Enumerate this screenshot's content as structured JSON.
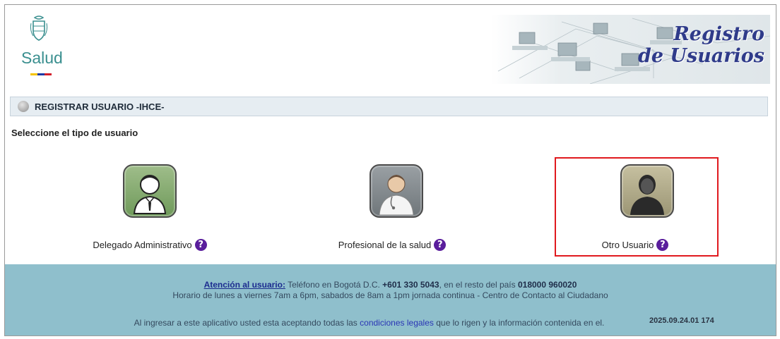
{
  "header": {
    "logo_text": "Salud",
    "banner_line1": "Registro",
    "banner_line2": "de Usuarios"
  },
  "titlebar": {
    "title": "REGISTRAR USUARIO -IHCE-"
  },
  "subtitle": "Seleccione el tipo de usuario",
  "options": [
    {
      "label": "Delegado Administrativo",
      "icon": "business-user-icon",
      "help": "?"
    },
    {
      "label": "Profesional de la salud",
      "icon": "doctor-icon",
      "help": "?"
    },
    {
      "label": "Otro Usuario",
      "icon": "generic-user-icon",
      "help": "?"
    }
  ],
  "footer": {
    "attention_link": "Atención al usuario:",
    "phone_prefix": " Teléfono en Bogotá D.C. ",
    "phone_bogota": "+601 330 5043",
    "phone_middle": ", en el resto del país ",
    "phone_national": "018000 960020",
    "hours": "Horario de lunes a viernes 7am a 6pm, sabados de 8am a 1pm jornada continua - Centro de Contacto al Ciudadano",
    "legal_prefix": "Al ingresar a este aplicativo usted esta aceptando todas las ",
    "legal_link": "condiciones legales",
    "legal_suffix": " que lo  rigen y la información contenida en el.",
    "version": "2025.09.24.01   174"
  },
  "colors": {
    "footer_bg": "#8fbfcc",
    "titlebar_bg": "#e6edf2",
    "selection_border": "#e0191e",
    "help_icon": "#5a1e9c",
    "banner_text": "#2f3b8a"
  }
}
